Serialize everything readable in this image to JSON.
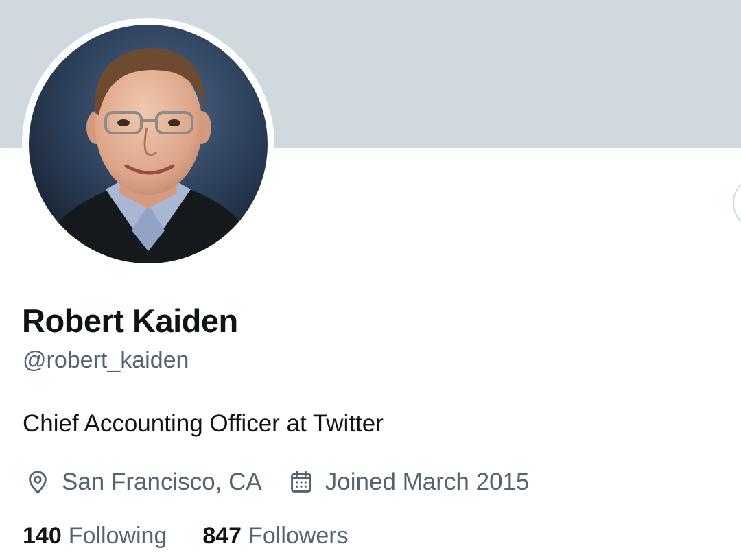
{
  "profile": {
    "display_name": "Robert Kaiden",
    "handle": "@robert_kaiden",
    "bio": "Chief Accounting Officer at Twitter",
    "location": "San Francisco, CA",
    "joined": "Joined March 2015",
    "following_count": "140",
    "following_label": "Following",
    "followers_count": "847",
    "followers_label": "Followers"
  },
  "icons": {
    "location": "location-pin-icon",
    "joined": "calendar-icon"
  },
  "colors": {
    "banner": "#cfd9de",
    "primary_text": "#0f1419",
    "secondary_text": "#536471",
    "background": "#ffffff"
  }
}
